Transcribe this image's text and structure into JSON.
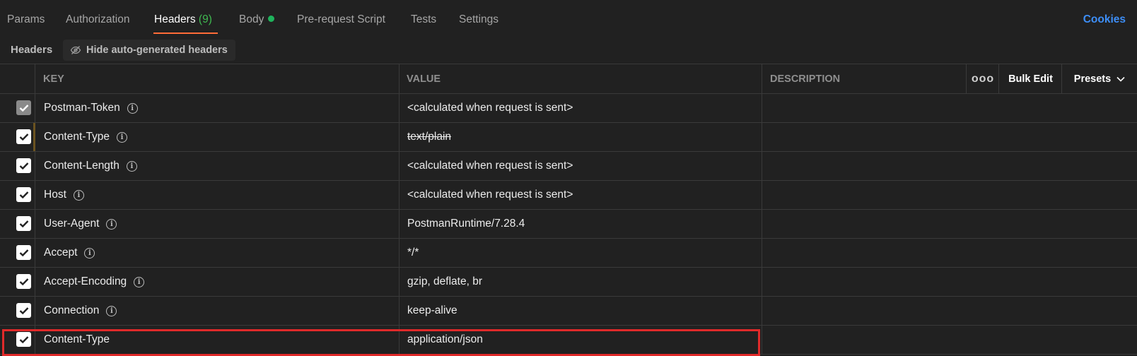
{
  "tabs": [
    {
      "label": "Params"
    },
    {
      "label": "Authorization"
    },
    {
      "label": "Headers",
      "count": "(9)"
    },
    {
      "label": "Body"
    },
    {
      "label": "Pre-request Script"
    },
    {
      "label": "Tests"
    },
    {
      "label": "Settings"
    }
  ],
  "cookies_label": "Cookies",
  "subbar": {
    "title": "Headers",
    "hide_label": "Hide auto-generated headers"
  },
  "table": {
    "columns": {
      "key": "KEY",
      "value": "VALUE",
      "description": "DESCRIPTION"
    },
    "more_label": "ooo",
    "bulk_edit_label": "Bulk Edit",
    "presets_label": "Presets",
    "rows": [
      {
        "key": "Postman-Token",
        "value": "<calculated when request is sent>",
        "checked": true
      },
      {
        "key": "Content-Type",
        "value": "text/plain",
        "checked": true
      },
      {
        "key": "Content-Length",
        "value": "<calculated when request is sent>",
        "checked": true
      },
      {
        "key": "Host",
        "value": "<calculated when request is sent>",
        "checked": true
      },
      {
        "key": "User-Agent",
        "value": "PostmanRuntime/7.28.4",
        "checked": true
      },
      {
        "key": "Accept",
        "value": "*/*",
        "checked": true
      },
      {
        "key": "Accept-Encoding",
        "value": "gzip, deflate, br",
        "checked": true
      },
      {
        "key": "Connection",
        "value": "keep-alive",
        "checked": true
      },
      {
        "key": "Content-Type",
        "value": "application/json",
        "checked": true
      }
    ]
  },
  "colors": {
    "accent": "#ff6c37",
    "link": "#3d8ef7",
    "body_dot": "#1fb35c",
    "highlight_border": "#e02a2a"
  }
}
